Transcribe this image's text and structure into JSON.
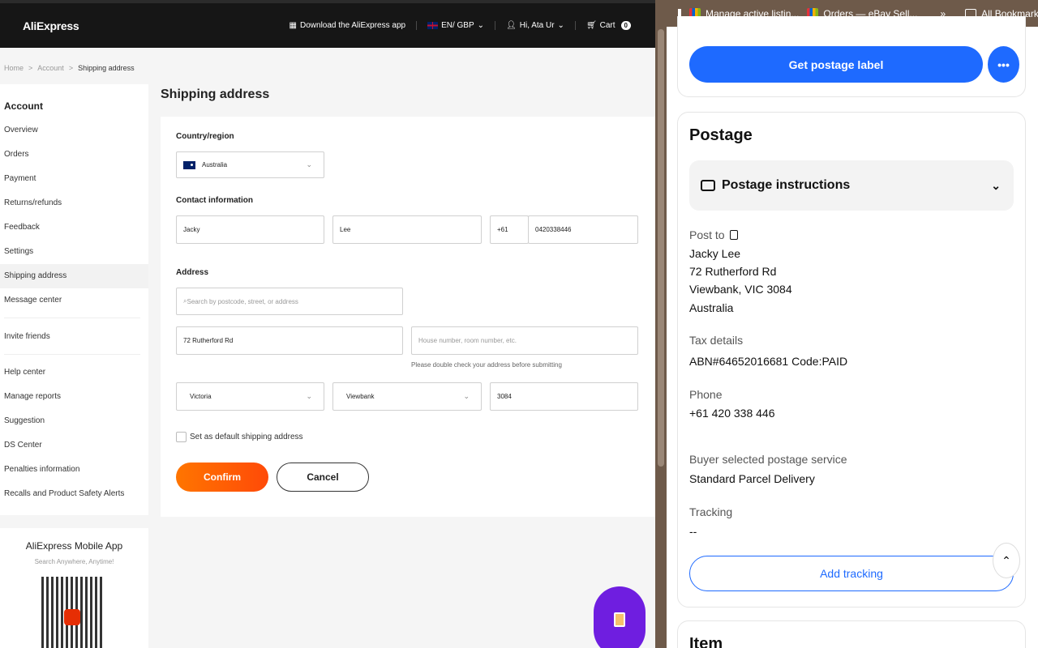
{
  "aliexpress": {
    "logo": "AliExpress",
    "header": {
      "download_app": "Download the AliExpress app",
      "locale": "EN/ GBP",
      "user": "Hi, Ata Ur",
      "cart_label": "Cart",
      "cart_count": "0"
    },
    "breadcrumb": [
      "Home",
      "Account",
      "Shipping address"
    ],
    "sidebar": {
      "title": "Account",
      "items": [
        "Overview",
        "Orders",
        "Payment",
        "Returns/refunds",
        "Feedback",
        "Settings",
        "Shipping address",
        "Message center",
        "Invite friends",
        "Help center",
        "Manage reports",
        "Suggestion",
        "DS Center",
        "Penalties information",
        "Recalls and Product Safety Alerts"
      ],
      "active": "Shipping address"
    },
    "app_promo": {
      "title": "AliExpress Mobile App",
      "subtitle": "Search Anywhere, Anytime!"
    },
    "form": {
      "title": "Shipping address",
      "country_label": "Country/region",
      "country_value": "Australia",
      "contact_label": "Contact information",
      "first_name": "Jacky",
      "last_name": "Lee",
      "phone_code": "+61",
      "phone": "0420338446",
      "address_label": "Address",
      "search_placeholder": "Search by postcode, street, or address",
      "street": "72 Rutherford Rd",
      "house_placeholder": "House number, room number, etc.",
      "address_hint": "Please double check your address before submitting",
      "state": "Victoria",
      "city": "Viewbank",
      "postcode": "3084",
      "default_label": "Set as default shipping address",
      "confirm": "Confirm",
      "cancel": "Cancel"
    }
  },
  "ebay": {
    "bookmarks": [
      "Manage active listin...",
      "Orders — eBay Sell..."
    ],
    "all_bookmarks": "All Bookmarks",
    "overflow": "»",
    "get_label": "Get postage label",
    "more": "•••",
    "postage_title": "Postage",
    "instructions": "Postage instructions",
    "post_to_label": "Post to",
    "address_lines": [
      "Jacky Lee",
      "72 Rutherford Rd",
      "Viewbank, VIC 3084",
      "Australia"
    ],
    "tax_label": "Tax details",
    "tax_value": "ABN#64652016681 Code:PAID",
    "phone_label": "Phone",
    "phone_value": "+61 420 338 446",
    "service_label": "Buyer selected postage service",
    "service_value": "Standard Parcel Delivery",
    "tracking_label": "Tracking",
    "tracking_value": "--",
    "add_tracking": "Add tracking",
    "item_title": "Item"
  }
}
